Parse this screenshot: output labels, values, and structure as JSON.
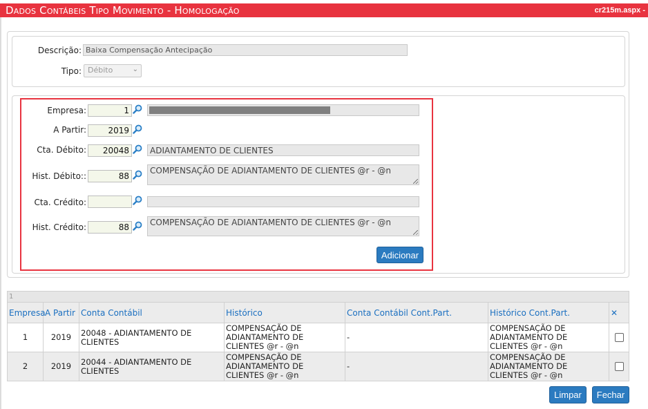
{
  "window": {
    "title": "Dados Contábeis Tipo Movimento  - Homologação",
    "page_file": "cr215m.aspx -"
  },
  "general": {
    "descricao_label": "Descrição:",
    "descricao_value": "Baixa Compensação Antecipação",
    "tipo_label": "Tipo:",
    "tipo_value": "Débito"
  },
  "form": {
    "empresa_label": "Empresa:",
    "empresa_code": "1",
    "a_partir_label": "A Partir:",
    "a_partir_value": "2019",
    "cta_debito_label": "Cta. Débito:",
    "cta_debito_code": "20048",
    "cta_debito_desc": "ADIANTAMENTO DE CLIENTES",
    "hist_debito_label": "Hist. Débito::",
    "hist_debito_code": "88",
    "hist_debito_text": "COMPENSAÇÃO DE ADIANTAMENTO DE CLIENTES @r - @n",
    "cta_credito_label": "Cta. Crédito:",
    "cta_credito_code": "",
    "cta_credito_desc": "",
    "hist_credito_label": "Hist. Crédito:",
    "hist_credito_code": "88",
    "hist_credito_text": "COMPENSAÇÃO DE ADIANTAMENTO DE CLIENTES @r - @n",
    "adicionar_label": "Adicionar"
  },
  "grid": {
    "page_number": "1",
    "columns": [
      "Empresa",
      "A Partir",
      "Conta Contábil",
      "Histórico",
      "Conta Contábil Cont.Part.",
      "Histórico Cont.Part."
    ],
    "rows": [
      {
        "empresa": "1",
        "a_partir": "2019",
        "conta": "20048 - ADIANTAMENTO DE CLIENTES",
        "historico": "COMPENSAÇÃO DE ADIANTAMENTO DE CLIENTES @r - @n",
        "conta_cp": "-",
        "historico_cp": "COMPENSAÇÃO DE ADIANTAMENTO DE CLIENTES @r - @n"
      },
      {
        "empresa": "2",
        "a_partir": "2019",
        "conta": "20044 - ADIANTAMENTO DE CLIENTES",
        "historico": "COMPENSAÇÃO DE ADIANTAMENTO DE CLIENTES @r - @n",
        "conta_cp": "-",
        "historico_cp": "COMPENSAÇÃO DE ADIANTAMENTO DE CLIENTES @r - @n"
      }
    ]
  },
  "footer": {
    "limpar_label": "Limpar",
    "fechar_label": "Fechar"
  },
  "icons": {
    "search": "magnifier-icon",
    "delete": "close-icon"
  },
  "colors": {
    "title_bar": "#e8333f",
    "button": "#2b7bc0",
    "grid_header_text": "#1a6fc0",
    "highlight_border": "#e8333f"
  }
}
